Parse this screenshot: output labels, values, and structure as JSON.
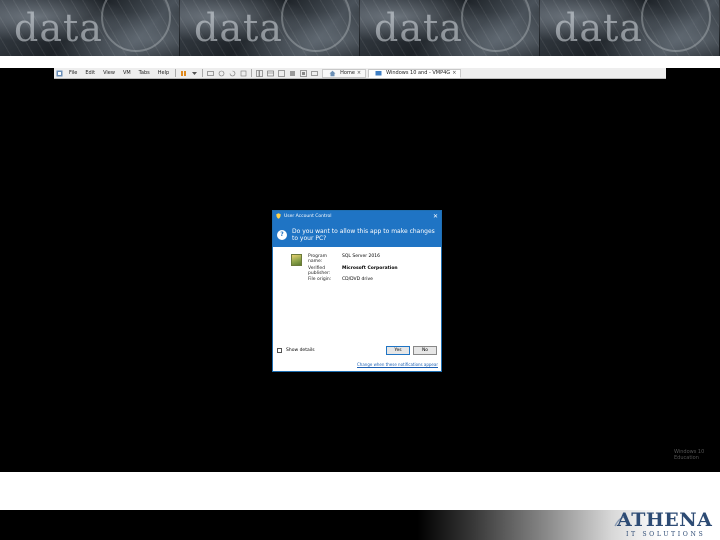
{
  "banner": {
    "tiles": [
      "data",
      "data",
      "data",
      "data"
    ]
  },
  "vm": {
    "menu": [
      "File",
      "Edit",
      "View",
      "VM",
      "Tabs",
      "Help"
    ],
    "tabs": [
      {
        "label": "Home"
      },
      {
        "label": "Windows 10 and - VMP4G"
      }
    ],
    "watermark": "Windows 10 Education"
  },
  "uac": {
    "title": "User Account Control",
    "question": "Do you want to allow this app to make changes to your PC?",
    "program_name_label": "Program name:",
    "program_name_value": "SQL Server 2016",
    "publisher_label": "Verified publisher:",
    "publisher_value": "Microsoft Corporation",
    "origin_label": "File origin:",
    "origin_value": "CD/DVD drive",
    "show_details": "Show details",
    "yes": "Yes",
    "no": "No",
    "link": "Change when these notifications appear"
  },
  "logo": {
    "brand": "ATHENA",
    "subtitle": "IT SOLUTIONS"
  },
  "colors": {
    "uac_blue": "#1f74c4",
    "logo_navy": "#2d4b74"
  }
}
